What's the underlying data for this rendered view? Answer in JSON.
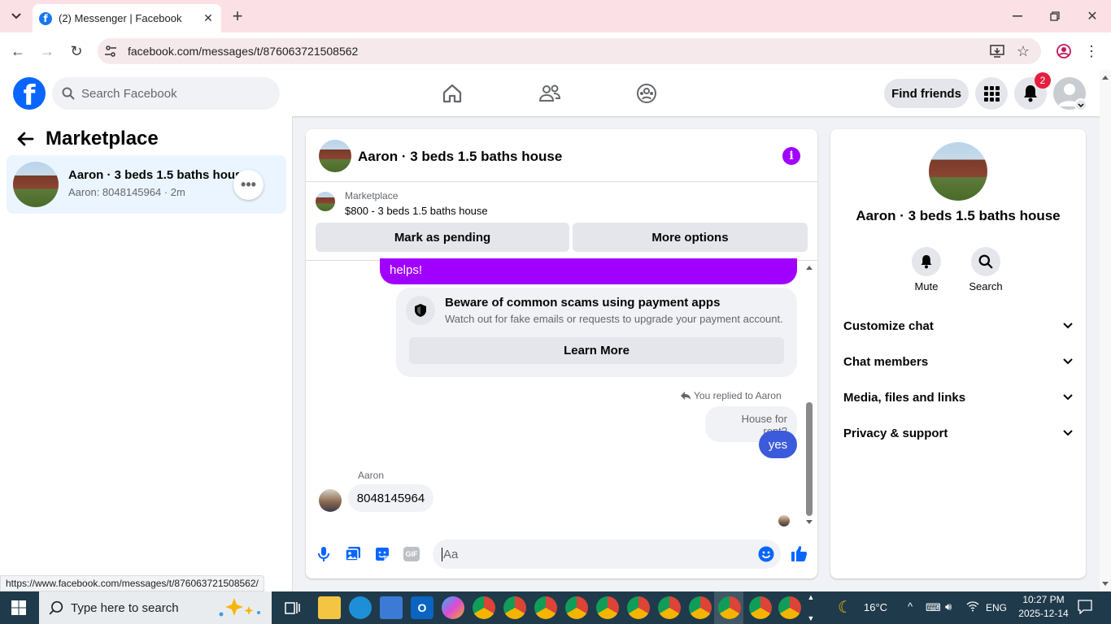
{
  "browser": {
    "tab_title": "(2) Messenger | Facebook",
    "url": "facebook.com/messages/t/876063721508562",
    "status_link": "https://www.facebook.com/messages/t/876063721508562/"
  },
  "header": {
    "search_placeholder": "Search Facebook",
    "find_friends": "Find friends",
    "notification_count": "2"
  },
  "left": {
    "title": "Marketplace",
    "conversation": {
      "name": "Aaron · 3 beds 1.5 baths house",
      "preview": "Aaron: 8048145964 · 2m"
    }
  },
  "chat": {
    "title": "Aaron · 3 beds 1.5 baths house",
    "listing_source": "Marketplace",
    "listing_desc": "$800 - 3 beds 1.5 baths house",
    "mark_pending": "Mark as pending",
    "more_options": "More options",
    "partial_bubble": "helps!",
    "scam_title": "Beware of common scams using payment apps",
    "scam_desc": "Watch out for fake emails or requests to upgrade your payment account.",
    "learn_more": "Learn More",
    "replied_label": "You replied to Aaron",
    "quoted": "House for rent?",
    "my_reply": "yes",
    "sender": "Aaron",
    "their_msg": "8048145964",
    "input_placeholder": "Aa"
  },
  "info": {
    "name": "Aaron · 3 beds 1.5 baths house",
    "mute": "Mute",
    "search": "Search",
    "rows": [
      "Customize chat",
      "Chat members",
      "Media, files and links",
      "Privacy & support"
    ]
  },
  "taskbar": {
    "search_placeholder": "Type here to search",
    "weather": "16°C",
    "lang": "ENG",
    "time": "10:27 PM",
    "date": "2025-12-14"
  },
  "colors": {
    "fb_blue": "#0866ff",
    "accent_purple": "#a100ff",
    "my_bubble": "#3b5bdb"
  }
}
